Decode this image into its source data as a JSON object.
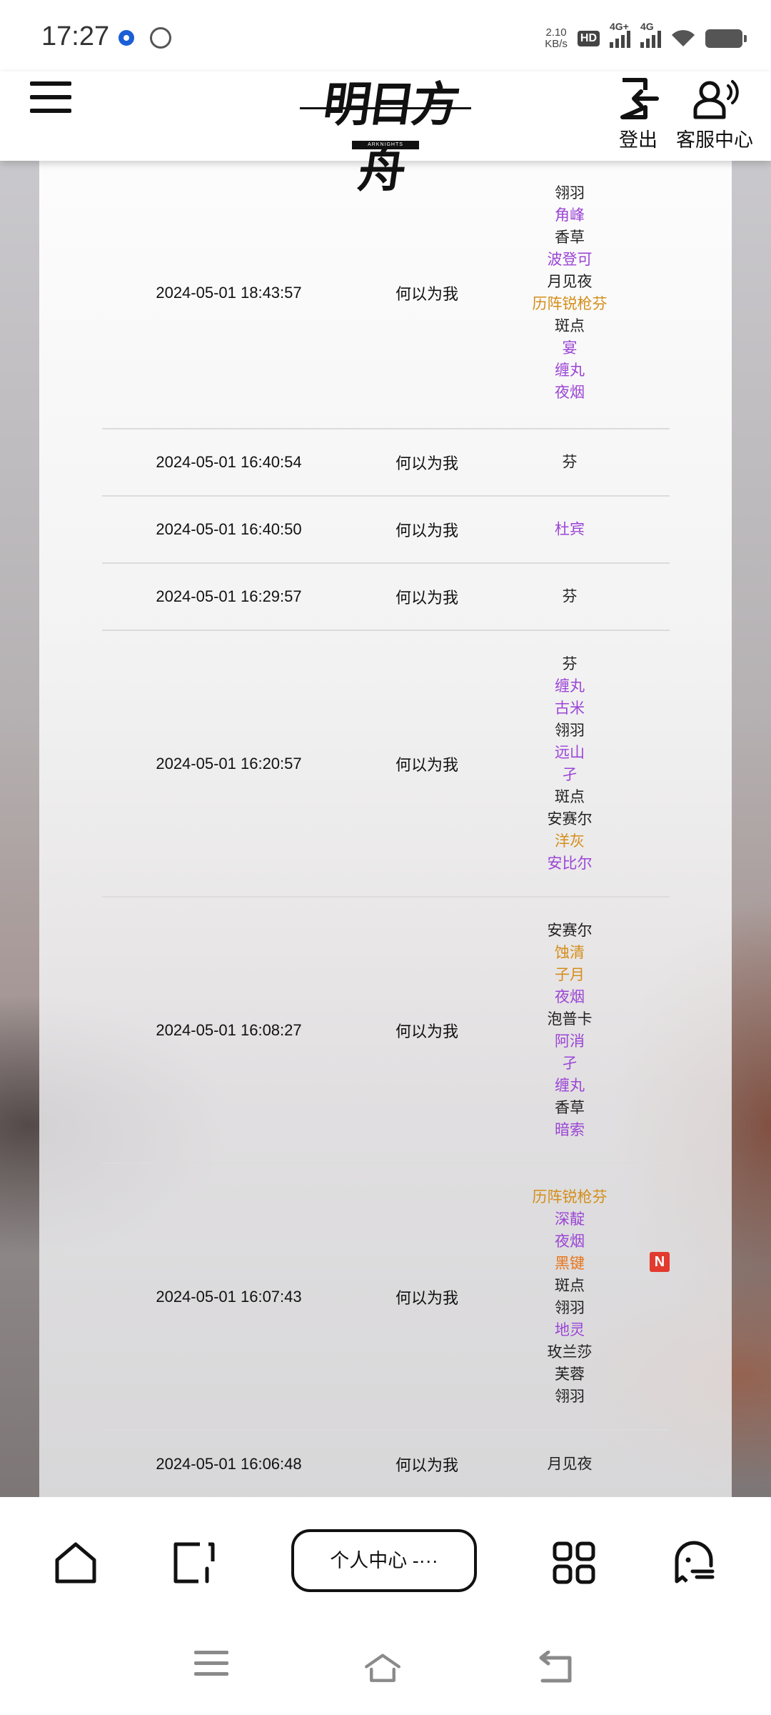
{
  "status_bar": {
    "time": "17:27",
    "net_speed_value": "2.10",
    "net_speed_unit": "KB/s",
    "hd_badge": "HD",
    "signal1_label": "4G+",
    "signal2_label": "4G"
  },
  "header": {
    "logo_text": "明日方舟",
    "logo_subtext": "ARKNIGHTS",
    "logout_label": "登出",
    "service_label": "客服中心"
  },
  "rows": [
    {
      "time": "2024-05-01 18:43:57",
      "name": "何以为我",
      "ops": [
        {
          "text": "翎羽",
          "rarity": 3
        },
        {
          "text": "角峰",
          "rarity": 4
        },
        {
          "text": "香草",
          "rarity": 3
        },
        {
          "text": "波登可",
          "rarity": 4
        },
        {
          "text": "月见夜",
          "rarity": 3
        },
        {
          "text": "历阵锐枪芬",
          "rarity": 5
        },
        {
          "text": "斑点",
          "rarity": 3
        },
        {
          "text": "宴",
          "rarity": 4
        },
        {
          "text": "缠丸",
          "rarity": 4
        },
        {
          "text": "夜烟",
          "rarity": 4
        }
      ]
    },
    {
      "time": "2024-05-01 16:40:54",
      "name": "何以为我",
      "ops": [
        {
          "text": "芬",
          "rarity": 3
        }
      ]
    },
    {
      "time": "2024-05-01 16:40:50",
      "name": "何以为我",
      "ops": [
        {
          "text": "杜宾",
          "rarity": 4
        }
      ]
    },
    {
      "time": "2024-05-01 16:29:57",
      "name": "何以为我",
      "ops": [
        {
          "text": "芬",
          "rarity": 3
        }
      ]
    },
    {
      "time": "2024-05-01 16:20:57",
      "name": "何以为我",
      "ops": [
        {
          "text": "芬",
          "rarity": 3
        },
        {
          "text": "缠丸",
          "rarity": 4
        },
        {
          "text": "古米",
          "rarity": 4
        },
        {
          "text": "翎羽",
          "rarity": 3
        },
        {
          "text": "远山",
          "rarity": 4
        },
        {
          "text": "孑",
          "rarity": 4
        },
        {
          "text": "斑点",
          "rarity": 3
        },
        {
          "text": "安赛尔",
          "rarity": 3
        },
        {
          "text": "洋灰",
          "rarity": 5
        },
        {
          "text": "安比尔",
          "rarity": 4
        }
      ]
    },
    {
      "time": "2024-05-01 16:08:27",
      "name": "何以为我",
      "ops": [
        {
          "text": "安赛尔",
          "rarity": 3
        },
        {
          "text": "蚀清",
          "rarity": 5
        },
        {
          "text": "子月",
          "rarity": 5
        },
        {
          "text": "夜烟",
          "rarity": 4
        },
        {
          "text": "泡普卡",
          "rarity": 3
        },
        {
          "text": "阿消",
          "rarity": 4
        },
        {
          "text": "孑",
          "rarity": 4
        },
        {
          "text": "缠丸",
          "rarity": 4
        },
        {
          "text": "香草",
          "rarity": 3
        },
        {
          "text": "暗索",
          "rarity": 4
        }
      ]
    },
    {
      "time": "2024-05-01 16:07:43",
      "name": "何以为我",
      "badge": "N",
      "ops": [
        {
          "text": "历阵锐枪芬",
          "rarity": 5
        },
        {
          "text": "深靛",
          "rarity": 4
        },
        {
          "text": "夜烟",
          "rarity": 4
        },
        {
          "text": "黑键",
          "rarity": 6
        },
        {
          "text": "斑点",
          "rarity": 3
        },
        {
          "text": "翎羽",
          "rarity": 3
        },
        {
          "text": "地灵",
          "rarity": 4
        },
        {
          "text": "玫兰莎",
          "rarity": 3
        },
        {
          "text": "芙蓉",
          "rarity": 3
        },
        {
          "text": "翎羽",
          "rarity": 3
        }
      ]
    },
    {
      "time": "2024-05-01 16:06:48",
      "name": "何以为我",
      "ops": [
        {
          "text": "月见夜",
          "rarity": 3
        }
      ]
    }
  ],
  "colors": {
    "rarity3": "#222222",
    "rarity4": "#9b45d6",
    "rarity5": "#d48e1a",
    "rarity6": "#e8751a",
    "new_badge": "#e23a2e"
  },
  "toolbar": {
    "address_label": "个人中心 -···",
    "icons": [
      "home-icon",
      "tabs-icon",
      "apps-grid-icon",
      "ghost-icon"
    ]
  },
  "navbar": {
    "icons": [
      "menu-icon",
      "home-icon",
      "back-icon"
    ]
  }
}
